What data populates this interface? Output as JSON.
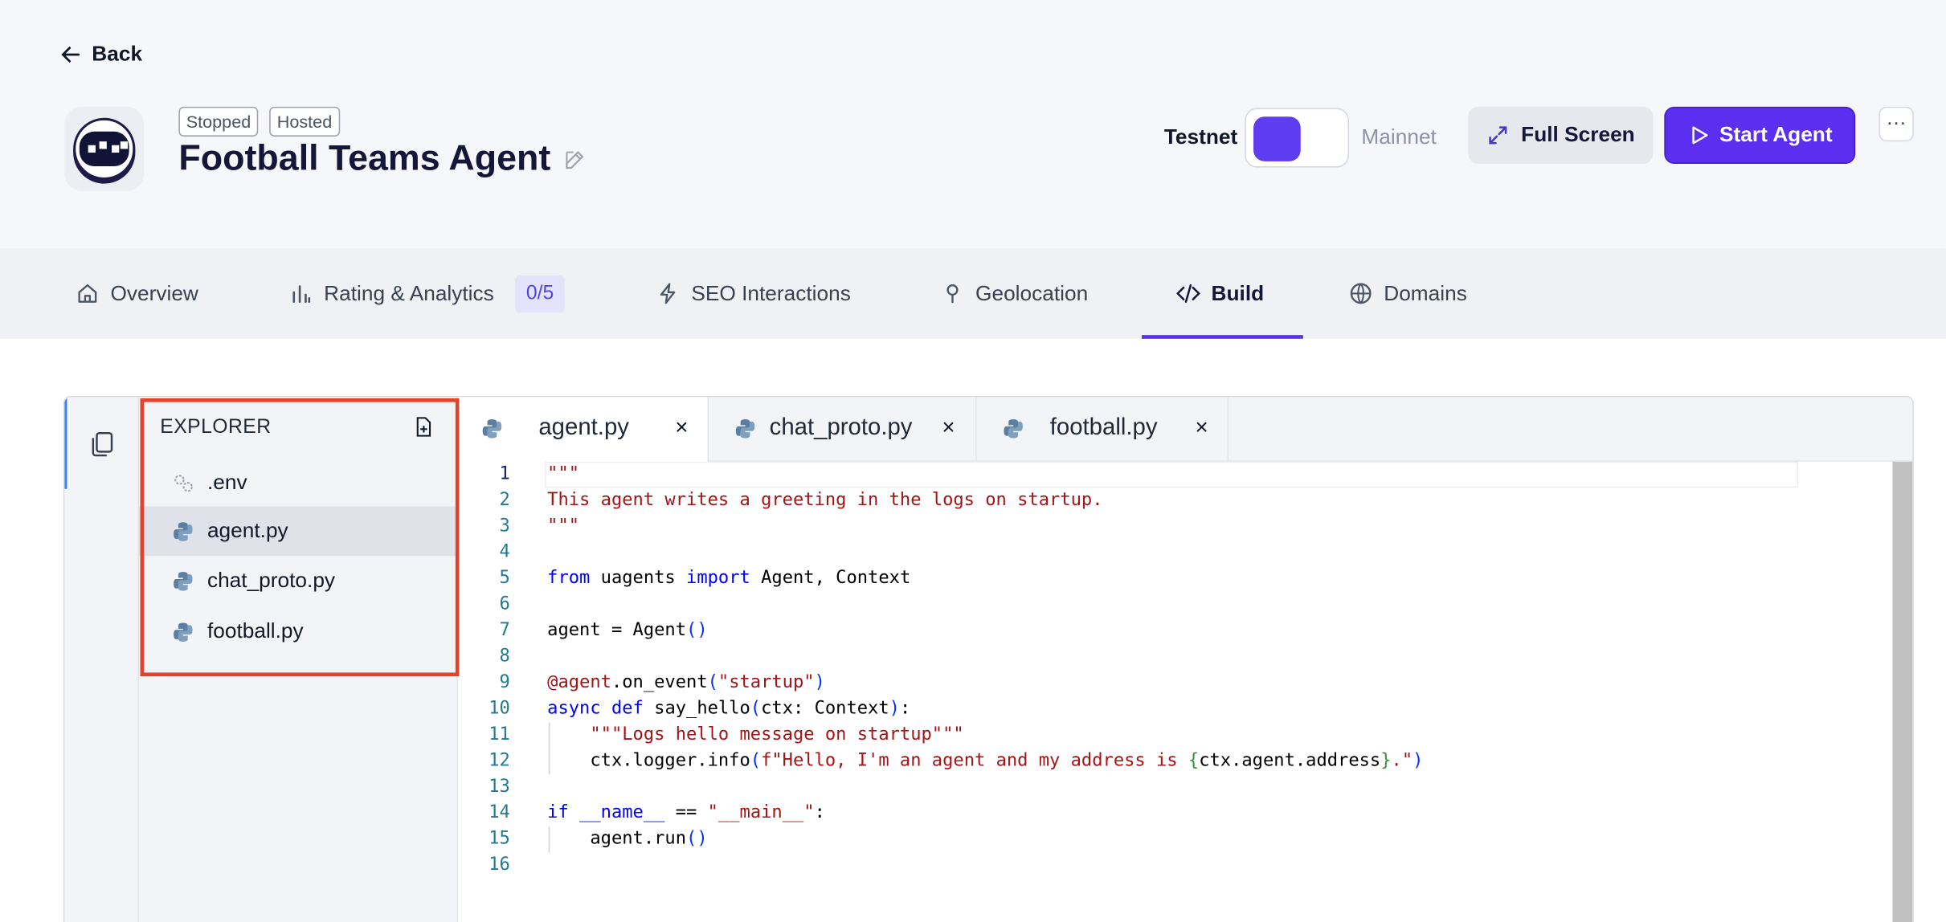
{
  "header": {
    "back_label": "Back",
    "badges": [
      "Stopped",
      "Hosted"
    ],
    "agent_title": "Football Teams Agent",
    "network": {
      "testnet_label": "Testnet",
      "mainnet_label": "Mainnet",
      "selected": "Testnet"
    },
    "full_screen_label": "Full Screen",
    "start_agent_label": "Start Agent",
    "more_label": "···"
  },
  "tabs": [
    {
      "label": "Overview",
      "icon": "home-icon"
    },
    {
      "label": "Rating & Analytics",
      "icon": "bar-chart-icon",
      "count": "0/5"
    },
    {
      "label": "SEO Interactions",
      "icon": "bolt-icon"
    },
    {
      "label": "Geolocation",
      "icon": "pin-icon"
    },
    {
      "label": "Build",
      "icon": "code-icon",
      "active": true
    },
    {
      "label": "Domains",
      "icon": "globe-icon"
    }
  ],
  "explorer": {
    "title": "EXPLORER",
    "files": [
      {
        "name": ".env",
        "icon": "gear-icon"
      },
      {
        "name": "agent.py",
        "icon": "python-icon",
        "selected": true
      },
      {
        "name": "chat_proto.py",
        "icon": "python-icon"
      },
      {
        "name": "football.py",
        "icon": "python-icon"
      }
    ]
  },
  "editor_tabs": [
    {
      "name": "agent.py",
      "active": true
    },
    {
      "name": "chat_proto.py"
    },
    {
      "name": "football.py"
    }
  ],
  "code_lines": [
    "\"\"\"",
    "This agent writes a greeting in the logs on startup.",
    "\"\"\"",
    "",
    "from uagents import Agent, Context",
    "",
    "agent = Agent()",
    "",
    "@agent.on_event(\"startup\")",
    "async def say_hello(ctx: Context):",
    "    \"\"\"Logs hello message on startup\"\"\"",
    "    ctx.logger.info(f\"Hello, I'm an agent and my address is {ctx.agent.address}.\")",
    "",
    "if __name__ == \"__main__\":",
    "    agent.run()",
    ""
  ],
  "colors": {
    "accent": "#5b2ef0",
    "highlight_box": "#e2432a",
    "keyword": "#0000ff",
    "string": "#a31515"
  }
}
